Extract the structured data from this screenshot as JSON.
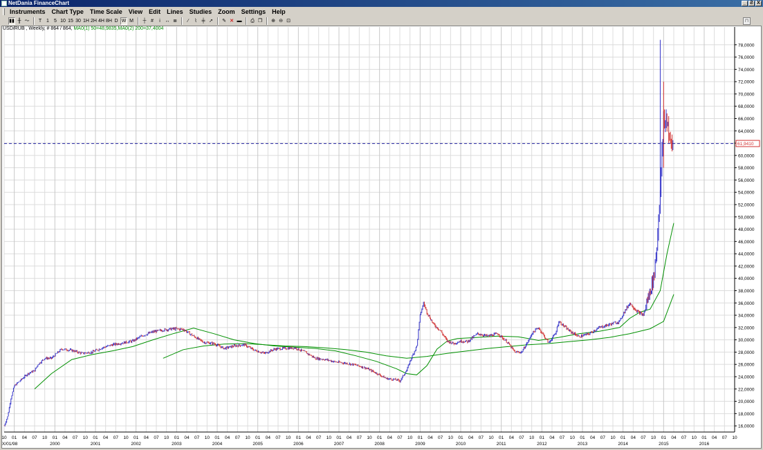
{
  "window": {
    "title": "NetDania FinanceChart",
    "buttons": [
      "_",
      "Ƨ",
      "X"
    ]
  },
  "menu": [
    "Instruments",
    "Chart Type",
    "Time Scale",
    "View",
    "Edit",
    "Lines",
    "Studies",
    "Zoom",
    "Settings",
    "Help"
  ],
  "toolbar": {
    "chart_types": [
      "bar-chart-icon",
      "candle-chart-icon",
      "line-chart-icon"
    ],
    "time_scales": [
      "T",
      "1",
      "5",
      "10",
      "15",
      "30",
      "1H",
      "2H",
      "4H",
      "8H",
      "D",
      "W",
      "M"
    ],
    "active_scale": "W",
    "tools": [
      "crosshair-icon",
      "grid-icon",
      "info-icon",
      "arrows-icon",
      "compare-icon",
      "trendline-icon",
      "fibonacci-icon",
      "channel-icon",
      "pointer-icon",
      "pencil-icon",
      "delete-icon",
      "erase-icon",
      "print-icon",
      "copy-icon",
      "zoom-in-icon",
      "zoom-out-icon",
      "zoom-reset-icon"
    ]
  },
  "legend": {
    "instrument": "USD/RUB , Weekly, # 864 / 864,",
    "ma1": "MA0(1) 50=48,9835,",
    "ma2": "MA0(2) 200=37,4004"
  },
  "colors": {
    "up": "#3030c8",
    "down": "#d03030",
    "ma": "#009000",
    "grid": "#dcdcdc",
    "last_price": "#2020a0"
  },
  "chart_data": {
    "type": "line",
    "title": "USD/RUB , Weekly",
    "ylim": [
      15,
      80
    ],
    "y_ticks": [
      "16,0000",
      "18,0000",
      "20,0000",
      "22,0000",
      "24,0000",
      "26,0000",
      "28,0000",
      "30,0000",
      "32,0000",
      "34,0000",
      "36,0000",
      "38,0000",
      "40,0000",
      "42,0000",
      "44,0000",
      "46,0000",
      "48,0000",
      "50,0000",
      "52,0000",
      "54,0000",
      "56,0000",
      "58,0000",
      "60,0000",
      "62,0000",
      "64,0000",
      "66,0000",
      "68,0000",
      "70,0000",
      "72,0000",
      "74,0000",
      "76,0000",
      "78,0000"
    ],
    "last_price": 61.941,
    "last_price_label": "61,9410",
    "x_start_label": "X/01/98",
    "x_range": [
      "1998-10",
      "2016-10"
    ],
    "year_labels": [
      "2000",
      "2001",
      "2002",
      "2003",
      "2004",
      "2005",
      "2006",
      "2007",
      "2008",
      "2009",
      "2010",
      "2011",
      "2012",
      "2013",
      "2014",
      "2015",
      "2016"
    ],
    "month_labels": [
      "10",
      "01",
      "04",
      "07"
    ],
    "series": [
      {
        "name": "USD/RUB",
        "x": [
          "1998-10",
          "1998-11",
          "1998-12",
          "1999-01",
          "1999-02",
          "1999-03",
          "1999-05",
          "1999-07",
          "1999-08",
          "1999-10",
          "1999-12",
          "2000-03",
          "2000-06",
          "2000-09",
          "2000-12",
          "2001-03",
          "2001-06",
          "2001-09",
          "2001-12",
          "2002-03",
          "2002-06",
          "2002-09",
          "2002-12",
          "2003-03",
          "2003-06",
          "2003-09",
          "2003-12",
          "2004-03",
          "2004-06",
          "2004-09",
          "2004-12",
          "2005-03",
          "2005-06",
          "2005-09",
          "2005-12",
          "2006-03",
          "2006-06",
          "2006-09",
          "2006-12",
          "2007-03",
          "2007-06",
          "2007-09",
          "2007-12",
          "2008-03",
          "2008-06",
          "2008-07",
          "2008-09",
          "2008-10",
          "2008-12",
          "2009-01",
          "2009-02",
          "2009-03",
          "2009-05",
          "2009-07",
          "2009-09",
          "2009-11",
          "2010-01",
          "2010-03",
          "2010-06",
          "2010-09",
          "2010-12",
          "2011-03",
          "2011-05",
          "2011-07",
          "2011-09",
          "2011-10",
          "2011-12",
          "2012-03",
          "2012-05",
          "2012-06",
          "2012-09",
          "2012-12",
          "2013-03",
          "2013-06",
          "2013-09",
          "2013-12",
          "2014-01",
          "2014-03",
          "2014-05",
          "2014-07",
          "2014-08",
          "2014-10",
          "2014-11",
          "2014-12",
          "2015-01",
          "2015-02",
          "2015-03",
          "2015-04"
        ],
        "y": [
          16.0,
          17.5,
          20.5,
          22.5,
          23.0,
          23.5,
          24.5,
          25.0,
          26.0,
          27.0,
          27.0,
          28.5,
          28.3,
          27.8,
          28.0,
          28.7,
          29.2,
          29.5,
          29.8,
          30.7,
          31.3,
          31.6,
          31.8,
          31.7,
          30.6,
          29.6,
          29.4,
          28.6,
          29.0,
          29.2,
          28.3,
          27.8,
          28.5,
          28.6,
          28.7,
          28.0,
          27.0,
          26.8,
          26.4,
          26.2,
          25.9,
          25.4,
          24.6,
          23.7,
          23.5,
          23.3,
          25.0,
          26.5,
          29.0,
          34.0,
          36.0,
          34.5,
          32.5,
          31.5,
          29.8,
          29.4,
          29.8,
          29.7,
          31.0,
          30.6,
          31.0,
          29.5,
          28.0,
          28.0,
          29.8,
          31.0,
          32.0,
          29.5,
          31.0,
          33.0,
          31.5,
          30.5,
          31.0,
          32.0,
          32.5,
          33.0,
          34.2,
          36.0,
          34.7,
          34.0,
          36.0,
          40.0,
          45.0,
          55.0,
          65.0,
          66.0,
          61.5,
          62.0
        ]
      },
      {
        "name": "MA0(1) 50",
        "x": [
          "1999-07",
          "1999-12",
          "2000-06",
          "2000-12",
          "2001-06",
          "2001-12",
          "2002-06",
          "2002-12",
          "2003-06",
          "2003-12",
          "2004-06",
          "2004-12",
          "2005-06",
          "2005-12",
          "2006-06",
          "2006-12",
          "2007-06",
          "2007-12",
          "2008-06",
          "2008-09",
          "2008-12",
          "2009-03",
          "2009-06",
          "2009-09",
          "2009-12",
          "2010-06",
          "2010-12",
          "2011-06",
          "2011-09",
          "2011-12",
          "2012-06",
          "2012-12",
          "2013-06",
          "2013-12",
          "2014-03",
          "2014-06",
          "2014-09",
          "2014-12",
          "2015-02",
          "2015-04"
        ],
        "y": [
          22.0,
          24.5,
          26.8,
          27.6,
          28.2,
          28.9,
          30.0,
          31.0,
          31.9,
          31.0,
          30.0,
          29.4,
          29.0,
          28.8,
          28.6,
          28.2,
          27.4,
          26.5,
          25.3,
          24.5,
          24.3,
          25.8,
          28.5,
          29.8,
          30.2,
          30.4,
          30.6,
          30.5,
          30.2,
          29.9,
          30.4,
          31.0,
          31.4,
          32.0,
          33.5,
          34.5,
          35.0,
          38.0,
          44.0,
          49.0
        ]
      },
      {
        "name": "MA0(2) 200",
        "x": [
          "2002-09",
          "2003-03",
          "2003-09",
          "2004-03",
          "2004-09",
          "2005-03",
          "2005-09",
          "2006-03",
          "2006-09",
          "2007-03",
          "2007-09",
          "2008-03",
          "2008-09",
          "2009-03",
          "2009-09",
          "2010-03",
          "2010-09",
          "2011-03",
          "2011-09",
          "2012-03",
          "2012-09",
          "2013-03",
          "2013-09",
          "2014-03",
          "2014-09",
          "2015-01",
          "2015-04"
        ],
        "y": [
          27.0,
          28.4,
          29.0,
          29.3,
          29.4,
          29.2,
          29.0,
          28.9,
          28.7,
          28.4,
          28.0,
          27.4,
          27.0,
          27.3,
          27.8,
          28.2,
          28.6,
          28.9,
          29.2,
          29.4,
          29.7,
          30.0,
          30.4,
          31.0,
          31.8,
          33.0,
          37.4
        ]
      }
    ]
  }
}
